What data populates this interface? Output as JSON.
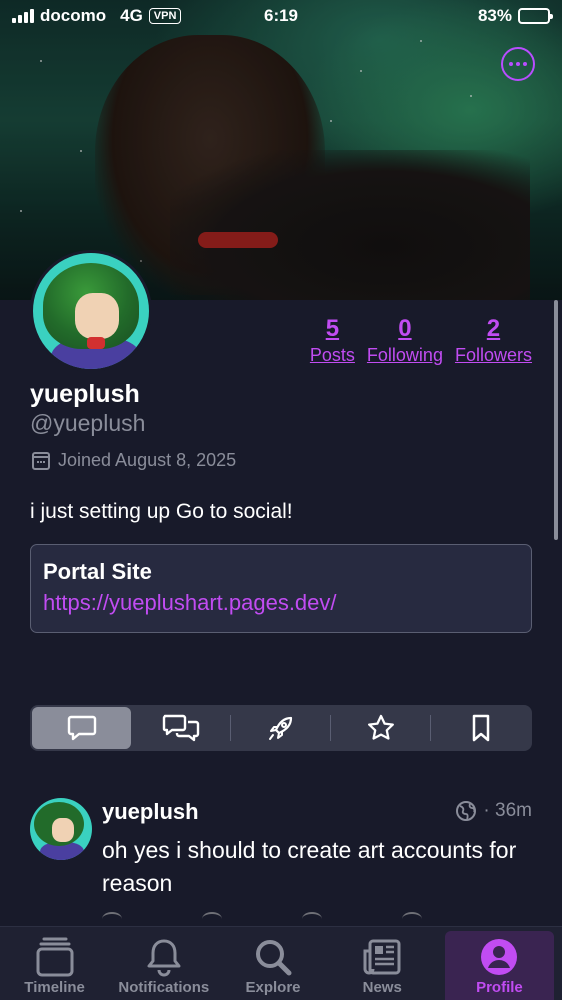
{
  "status_bar": {
    "carrier": "docomo",
    "network": "4G",
    "vpn": "VPN",
    "time": "6:19",
    "battery_text": "83%",
    "battery_level": 0.83
  },
  "profile": {
    "display_name": "yueplush",
    "handle": "@yueplush",
    "joined": "Joined August 8, 2025",
    "bio": "i just setting up Go to social!",
    "stats": [
      {
        "value": "5",
        "label": "Posts"
      },
      {
        "value": "0",
        "label": "Following"
      },
      {
        "value": "2",
        "label": "Followers"
      }
    ],
    "field": {
      "name": "Portal Site",
      "value": "https://yueplushart.pages.dev/"
    }
  },
  "tabs": [
    {
      "icon": "posts-icon",
      "active": true
    },
    {
      "icon": "replies-icon",
      "active": false
    },
    {
      "icon": "boosts-icon",
      "active": false
    },
    {
      "icon": "favourites-icon",
      "active": false
    },
    {
      "icon": "bookmarks-icon",
      "active": false
    }
  ],
  "post": {
    "author": "yueplush",
    "visibility_icon": "globe-icon",
    "time": "· 36m",
    "text": "oh yes i should to create art accounts for reason"
  },
  "bottom_nav": [
    {
      "label": "Timeline",
      "icon": "timeline-icon",
      "active": false
    },
    {
      "label": "Notifications",
      "icon": "bell-icon",
      "active": false
    },
    {
      "label": "Explore",
      "icon": "search-icon",
      "active": false
    },
    {
      "label": "News",
      "icon": "news-icon",
      "active": false
    },
    {
      "label": "Profile",
      "icon": "profile-icon",
      "active": true
    }
  ],
  "colors": {
    "accent": "#c14cf2",
    "background": "#181a2a",
    "muted": "#8a8d9a"
  }
}
